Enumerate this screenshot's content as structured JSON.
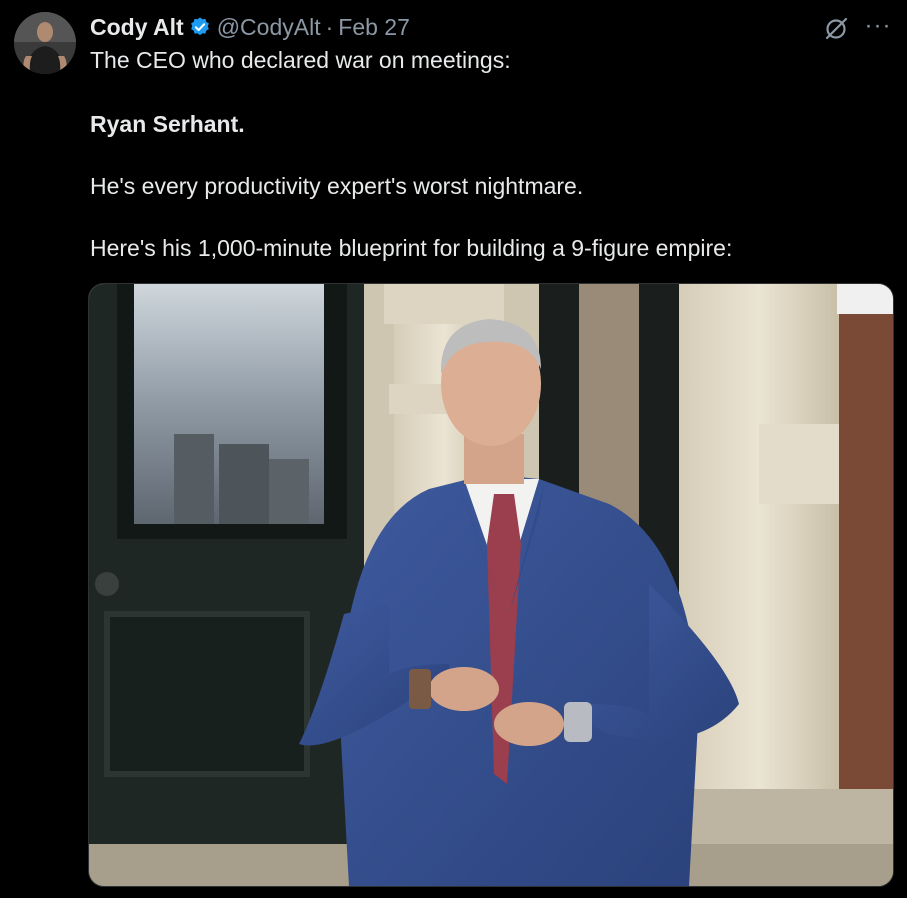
{
  "tweet": {
    "author": {
      "name": "Cody Alt",
      "handle": "@CodyAlt",
      "verified_icon": "verified-badge-icon"
    },
    "separator": "·",
    "date": "Feb 27",
    "lines": [
      "The CEO who declared war on meetings:",
      "Ryan Serhant.",
      "He's every productivity expert's worst nightmare.",
      "Here's his 1,000-minute blueprint for building a 9-figure empire:"
    ],
    "more_label": "···",
    "media": {
      "type": "photo"
    }
  },
  "colors": {
    "background": "#000000",
    "text": "#e7e9ea",
    "secondary": "#8b98a5",
    "verified": "#1d9bf0"
  }
}
